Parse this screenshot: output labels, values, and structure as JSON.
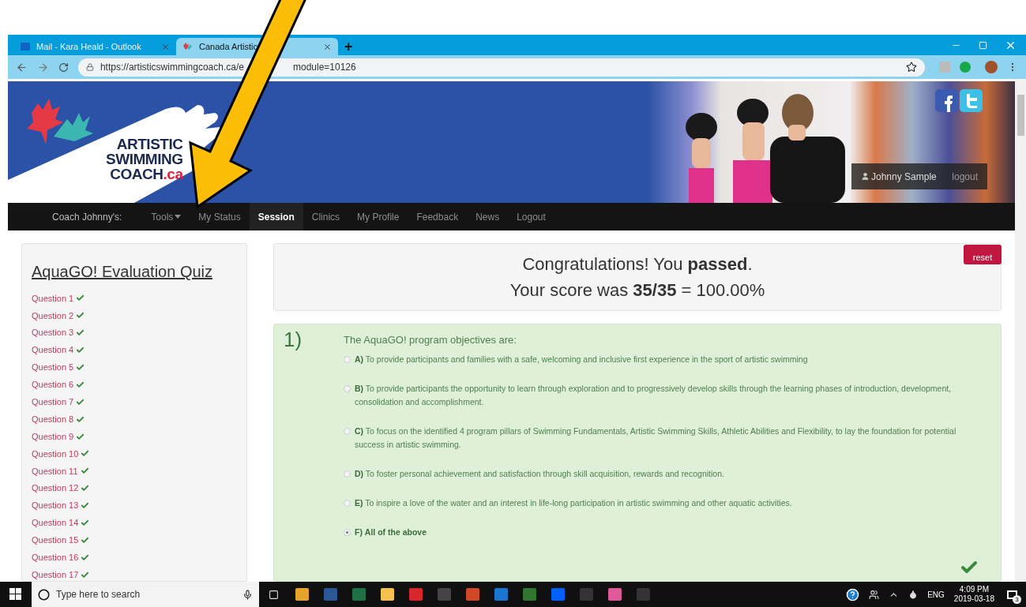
{
  "browser": {
    "tabs": [
      {
        "title": "Mail - Kara Heald - Outlook",
        "kind": "mail",
        "selected": false
      },
      {
        "title": "Canada Artistic",
        "kind": "site",
        "selected": true
      }
    ],
    "new_tab": "+",
    "url_start": "https://artisticswimmingcoach.ca/e",
    "url_end": "module=10126"
  },
  "site": {
    "logo_lines": [
      "ARTISTIC",
      "SWIMMING"
    ],
    "logo_last": "COACH",
    "logo_suffix": ".ca",
    "user": {
      "name": "Johnny Sample",
      "logout": "logout"
    }
  },
  "nav": {
    "brand": "Coach Johnny's:",
    "items": [
      {
        "label": "Tools",
        "kind": "dropdown",
        "selected": false
      },
      {
        "label": "My Status",
        "kind": "link",
        "selected": false
      },
      {
        "label": "Session",
        "kind": "link",
        "selected": true
      },
      {
        "label": "Clinics",
        "kind": "link",
        "selected": false
      },
      {
        "label": "My Profile",
        "kind": "link",
        "selected": false
      },
      {
        "label": "Feedback",
        "kind": "link",
        "selected": false
      },
      {
        "label": "News",
        "kind": "link",
        "selected": false
      },
      {
        "label": "Logout",
        "kind": "link",
        "selected": false
      }
    ]
  },
  "sidebar": {
    "title": "AquaGO! Evaluation Quiz",
    "questions": [
      {
        "label": "Question 1",
        "correct": true
      },
      {
        "label": "Question 2",
        "correct": true
      },
      {
        "label": "Question 3",
        "correct": true
      },
      {
        "label": "Question 4",
        "correct": true
      },
      {
        "label": "Question 5",
        "correct": true
      },
      {
        "label": "Question 6",
        "correct": true
      },
      {
        "label": "Question 7",
        "correct": true
      },
      {
        "label": "Question 8",
        "correct": true
      },
      {
        "label": "Question 9",
        "correct": true
      },
      {
        "label": "Question 10",
        "correct": true
      },
      {
        "label": "Question 11",
        "correct": true
      },
      {
        "label": "Question 12",
        "correct": true
      },
      {
        "label": "Question 13",
        "correct": true
      },
      {
        "label": "Question 14",
        "correct": true
      },
      {
        "label": "Question 15",
        "correct": true
      },
      {
        "label": "Question 16",
        "correct": true
      },
      {
        "label": "Question 17",
        "correct": true
      }
    ]
  },
  "result": {
    "line1": "Congratulations! You **passed**.",
    "line2": "Your score was **35/35** = 100.00%",
    "reset": "reset"
  },
  "question": {
    "number": "1)",
    "prompt": "The AquaGO! program objectives are:",
    "correct": true,
    "options": [
      {
        "letter": "A)",
        "text": "To provide participants and families with a safe, welcoming and inclusive first experience in the sport of artistic swimming",
        "selected": false
      },
      {
        "letter": "B)",
        "text": "To provide participants the opportunity to learn through exploration and to progressively develop skills through the learning phases of introduction, development, consolidation and accomplishment.",
        "selected": false
      },
      {
        "letter": "C)",
        "text": "To focus on the identified 4 program pillars of Swimming Fundamentals, Artistic Swimming Skills, Athletic Abilities and Flexibility, to lay the foundation for potential success in artistic swimming.",
        "selected": false
      },
      {
        "letter": "D)",
        "text": "To foster personal achievement and satisfaction through skill acquisition, rewards and recognition.",
        "selected": false
      },
      {
        "letter": "E)",
        "text": "To inspire a love of the water and an interest in life-long participation in artistic swimming and other aquatic activities.",
        "selected": false
      },
      {
        "letter": "F)",
        "text": "All of the above",
        "selected": true
      }
    ]
  },
  "taskbar": {
    "search_placeholder": "Type here to search",
    "language": "ENG",
    "time": "4:09 PM",
    "date": "2019-03-18",
    "notifications": "3"
  }
}
